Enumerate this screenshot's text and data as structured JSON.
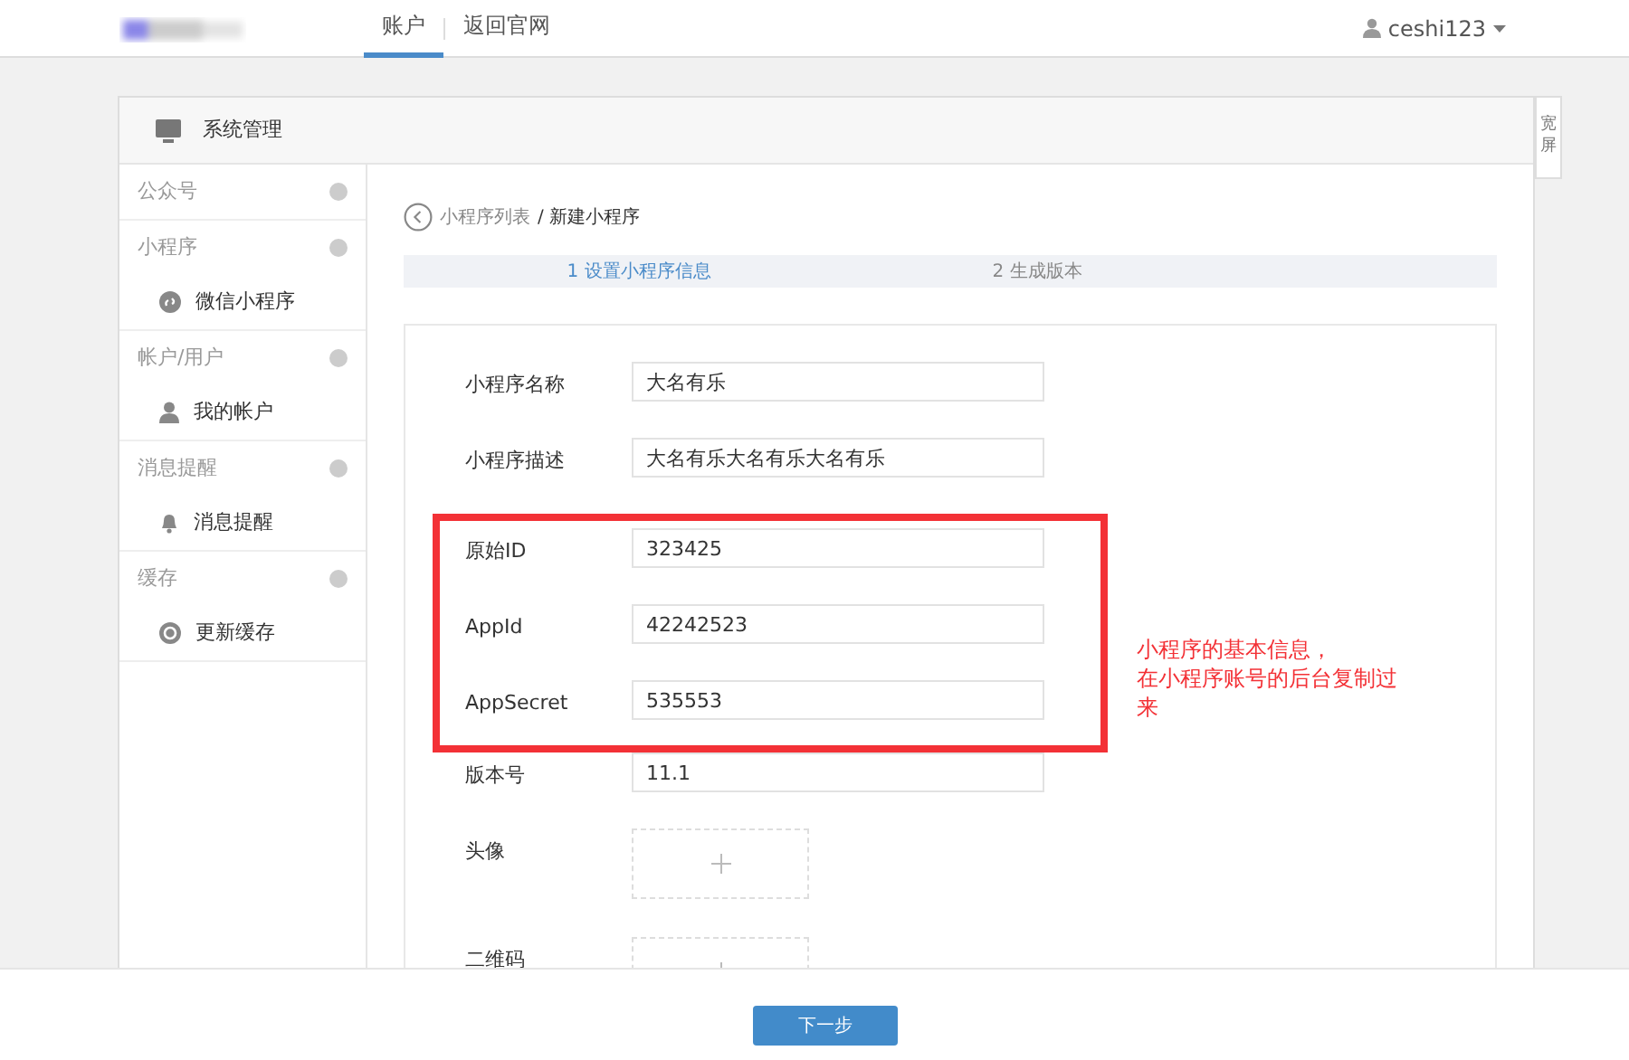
{
  "navbar": {
    "tabs": [
      {
        "label": "账户",
        "selected": true
      },
      {
        "label": "返回官网",
        "selected": false
      }
    ],
    "user": "ceshi123"
  },
  "panel": {
    "title": "系统管理",
    "wide_toggle": "宽屏"
  },
  "sidebar": [
    {
      "title": "公众号"
    },
    {
      "title": "小程序",
      "items": [
        {
          "label": "微信小程序"
        }
      ]
    },
    {
      "title": "帐户/用户",
      "items": [
        {
          "label": "我的帐户"
        }
      ]
    },
    {
      "title": "消息提醒",
      "items": [
        {
          "label": "消息提醒"
        }
      ]
    },
    {
      "title": "缓存",
      "items": [
        {
          "label": "更新缓存"
        }
      ]
    }
  ],
  "breadcrumb": {
    "parent": "小程序列表",
    "separator": "/",
    "current": "新建小程序"
  },
  "steps": [
    {
      "label": "1 设置小程序信息",
      "selected": true
    },
    {
      "label": "2 生成版本",
      "selected": false
    }
  ],
  "form": [
    {
      "kind": "text",
      "label": "小程序名称",
      "value": "大名有乐",
      "highlighted": false
    },
    {
      "kind": "text",
      "label": "小程序描述",
      "value": "大名有乐大名有乐大名有乐",
      "highlighted": false
    },
    {
      "kind": "text",
      "label": "原始ID",
      "value": "323425",
      "highlighted": true
    },
    {
      "kind": "text",
      "label": "AppId",
      "value": "42242523",
      "highlighted": true
    },
    {
      "kind": "text",
      "label": "AppSecret",
      "value": "535553",
      "highlighted": true
    },
    {
      "kind": "text",
      "label": "版本号",
      "value": "11.1",
      "highlighted": false
    },
    {
      "kind": "upload",
      "label": "头像",
      "highlighted": false
    },
    {
      "kind": "upload",
      "label": "二维码",
      "highlighted": false
    }
  ],
  "annotation": [
    "小程序的基本信息，",
    "在小程序账号的后台复制过来"
  ],
  "next_button": "下一步"
}
